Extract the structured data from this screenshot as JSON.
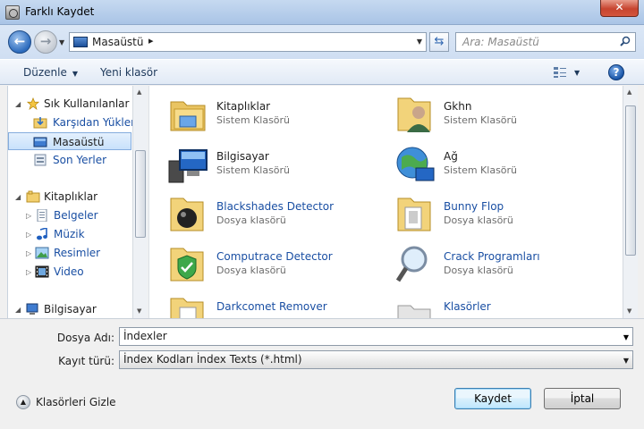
{
  "window": {
    "title": "Farklı Kaydet",
    "close_label": "✕"
  },
  "address": {
    "location": "Masaüstü",
    "separator": "▸",
    "search_placeholder": "Ara: Masaüstü"
  },
  "toolbar": {
    "organize_label": "Düzenle",
    "new_folder_label": "Yeni klasör",
    "help_label": "?"
  },
  "sidebar": {
    "favorites_label": "Sık Kullanılanlar",
    "favorites": [
      {
        "label": "Karşıdan Yüklem",
        "icon": "download-folder-icon"
      },
      {
        "label": "Masaüstü",
        "icon": "desktop-icon",
        "selected": true
      },
      {
        "label": "Son Yerler",
        "icon": "recent-places-icon"
      }
    ],
    "libraries_label": "Kitaplıklar",
    "libraries": [
      {
        "label": "Belgeler",
        "icon": "documents-icon"
      },
      {
        "label": "Müzik",
        "icon": "music-icon"
      },
      {
        "label": "Resimler",
        "icon": "pictures-icon"
      },
      {
        "label": "Video",
        "icon": "video-icon"
      }
    ],
    "computer_label": "Bilgisayar"
  },
  "files": [
    {
      "name": "Kitaplıklar",
      "type": "Sistem Klasörü",
      "icon": "libraries-folder-icon"
    },
    {
      "name": "Gkhn",
      "type": "Sistem Klasörü",
      "icon": "user-folder-icon"
    },
    {
      "name": "Bilgisayar",
      "type": "Sistem Klasörü",
      "icon": "computer-icon"
    },
    {
      "name": "Ağ",
      "type": "Sistem Klasörü",
      "icon": "network-icon"
    },
    {
      "name": "Blackshades Detector",
      "type": "Dosya klasörü",
      "icon": "folder-icon"
    },
    {
      "name": "Bunny Flop",
      "type": "Dosya klasörü",
      "icon": "folder-icon"
    },
    {
      "name": "Computrace Detector",
      "type": "Dosya klasörü",
      "icon": "folder-icon"
    },
    {
      "name": "Crack Programları",
      "type": "Dosya klasörü",
      "icon": "search-folder-icon"
    },
    {
      "name": "Darkcomet Remover",
      "type": "",
      "icon": "folder-icon"
    },
    {
      "name": "Klasörler",
      "type": "",
      "icon": "folder-icon"
    }
  ],
  "form": {
    "filename_label": "Dosya Adı:",
    "filename_value": "İndexler",
    "filetype_label": "Kayıt türü:",
    "filetype_value": "İndex Kodları İndex Texts (*.html)"
  },
  "footer": {
    "hide_folders_label": "Klasörleri Gizle",
    "save_label": "Kaydet",
    "cancel_label": "İptal"
  }
}
